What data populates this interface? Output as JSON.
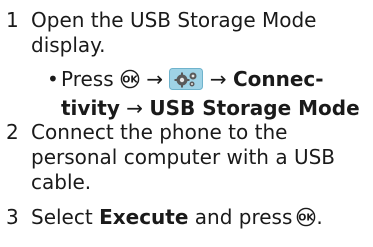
{
  "steps": [
    {
      "number": "1",
      "text_line1": "Open the USB Storage Mode",
      "text_line2": "display.",
      "sub": {
        "bullet": "•",
        "press": "Press",
        "arrow1": "→",
        "arrow2": "→",
        "bold1": "Connec-",
        "bold2": "tivity",
        "arrow3": "→",
        "bold3": "USB Storage Mode",
        "key_icon": "ok-key-icon",
        "menu_icon": "settings-gears-icon"
      }
    },
    {
      "number": "2",
      "text_line1": "Connect the phone to the",
      "text_line2": "personal computer with a USB",
      "text_line3": "cable."
    },
    {
      "number": "3",
      "text_pre": "Select",
      "text_bold": "Execute",
      "text_mid": "and press",
      "text_end": ".",
      "key_icon": "ok-key-icon"
    }
  ],
  "colors": {
    "text": "#1a1a1a",
    "menu_icon_bg": "#9fd3e6",
    "menu_icon_fg": "#5a5a5a"
  }
}
